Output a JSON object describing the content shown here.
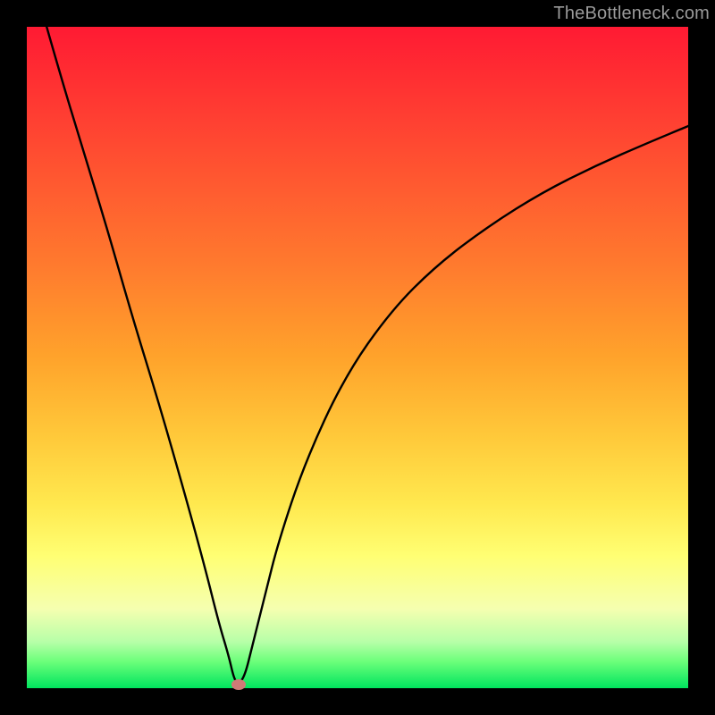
{
  "watermark": "TheBottleneck.com",
  "chart_data": {
    "type": "line",
    "title": "",
    "xlabel": "",
    "ylabel": "",
    "xlim": [
      0,
      100
    ],
    "ylim": [
      0,
      100
    ],
    "series": [
      {
        "name": "bottleneck-curve",
        "x": [
          3,
          5,
          8,
          12,
          16,
          20,
          24,
          27,
          29,
          30.5,
          31.3,
          32,
          33,
          34,
          36,
          38,
          42,
          48,
          55,
          62,
          70,
          78,
          86,
          94,
          100
        ],
        "y": [
          100,
          93,
          83,
          70,
          56,
          43,
          29,
          18,
          10,
          5,
          1.5,
          0.5,
          2,
          6,
          14,
          22,
          34,
          47,
          57,
          64,
          70,
          75,
          79,
          82.5,
          85
        ]
      }
    ],
    "marker": {
      "x": 32,
      "y": 0.5,
      "color": "#cf7b76"
    },
    "background_gradient": {
      "top": "#ff1a33",
      "mid": "#ffe84e",
      "bottom": "#00e45e"
    }
  }
}
